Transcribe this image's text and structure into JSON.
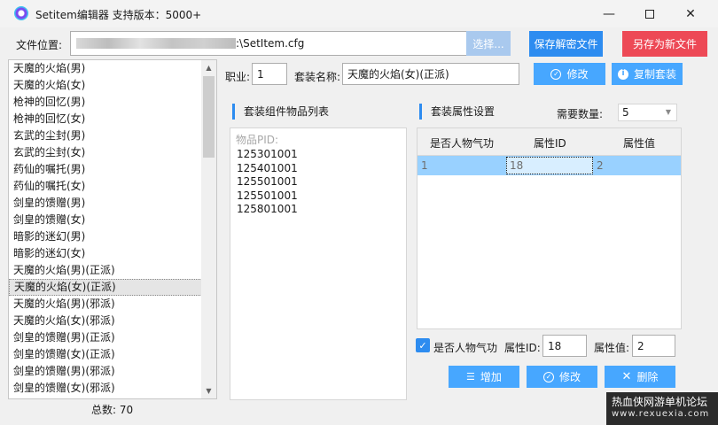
{
  "window": {
    "title": "Setitem编辑器 支持版本：5000+"
  },
  "file": {
    "label": "文件位置:",
    "path": ":\\SetItem.cfg",
    "browse_label": "选择...",
    "save_decrypt_label": "保存解密文件",
    "save_new_label": "另存为新文件"
  },
  "set_list": {
    "items": [
      "天魔的火焰(男)",
      "天魔的火焰(女)",
      "枪神的回忆(男)",
      "枪神的回忆(女)",
      "玄武的尘封(男)",
      "玄武的尘封(女)",
      "药仙的嘱托(男)",
      "药仙的嘱托(女)",
      "剑皇的馈赠(男)",
      "剑皇的馈赠(女)",
      "暗影的迷幻(男)",
      "暗影的迷幻(女)",
      "天魔的火焰(男)(正派)",
      "天魔的火焰(女)(正派)",
      "天魔的火焰(男)(邪派)",
      "天魔的火焰(女)(邪派)",
      "剑皇的馈赠(男)(正派)",
      "剑皇的馈赠(女)(正派)",
      "剑皇的馈赠(男)(邪派)",
      "剑皇的馈赠(女)(邪派)"
    ],
    "selected_index": 13,
    "total_label": "总数:",
    "total_value": "70"
  },
  "detail": {
    "job_label": "职业:",
    "job_value": "1",
    "set_name_label": "套装名称:",
    "set_name_value": "天魔的火焰(女)(正派)",
    "modify_label": "修改",
    "copy_label": "复制套装"
  },
  "components": {
    "title": "套装组件物品列表",
    "pid_label": "物品PID:",
    "pids": [
      "125301001",
      "125401001",
      "125501001",
      "125501001",
      "125801001"
    ]
  },
  "attributes": {
    "title": "套装属性设置",
    "required_count_label": "需要数量:",
    "required_count_value": "5",
    "columns": [
      "是否人物气功",
      "属性ID",
      "属性值"
    ],
    "rows": [
      {
        "qigong": "1",
        "attr_id": "18",
        "attr_value": "2"
      }
    ],
    "qigong_checked": true,
    "qigong_label": "是否人物气功",
    "attr_id_label": "属性ID:",
    "attr_id_value": "18",
    "attr_value_label": "属性值:",
    "attr_value_value": "2",
    "add_label": "增加",
    "modify_label": "修改",
    "delete_label": "删除"
  },
  "watermark": {
    "line1": "热血侠网游单机论坛",
    "line2": "www.rexuexia.com"
  },
  "colors": {
    "accent": "#2d8cf0",
    "accent_light": "#47a7ff",
    "danger": "#ed4956",
    "selection": "#99d1ff"
  }
}
